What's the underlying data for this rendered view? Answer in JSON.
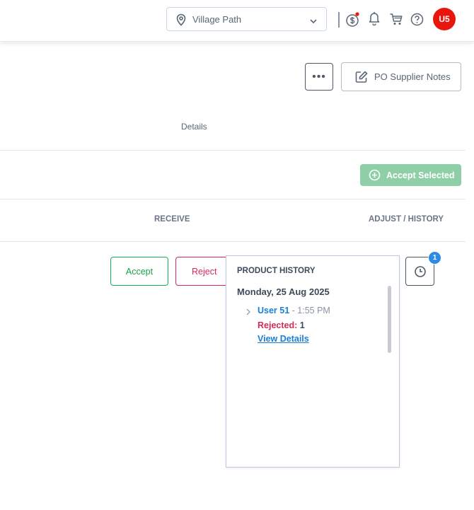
{
  "header": {
    "location": "Village Path",
    "avatar_initials": "U5"
  },
  "toolbar": {
    "more_label": "•••",
    "supplier_notes_label": "PO Supplier Notes"
  },
  "table": {
    "details_header": "Details",
    "accept_selected_label": "Accept Selected",
    "receive_header": "RECEIVE",
    "adjust_header": "ADJUST / HISTORY"
  },
  "row": {
    "accept_label": "Accept",
    "reject_label": "Reject",
    "history_badge": "1"
  },
  "history": {
    "title": "PRODUCT HISTORY",
    "date": "Monday, 25 Aug 2025",
    "entries": [
      {
        "user": "User 51",
        "time": " - 1:55 PM",
        "status_label": "Rejected:",
        "count": "1",
        "link": "View Details"
      }
    ]
  },
  "colors": {
    "accept": "#16a34a",
    "reject": "#d42a57",
    "accept_selected_bg": "#8fcfa7",
    "link": "#1a7fd4",
    "avatar": "#e8160c",
    "badge": "#2d8be6"
  },
  "icons": [
    "location-pin-icon",
    "chevron-down-icon",
    "payment-icon",
    "bell-icon",
    "cart-icon",
    "help-icon",
    "edit-icon",
    "plus-circle-icon",
    "clock-icon",
    "chevron-right-icon"
  ]
}
